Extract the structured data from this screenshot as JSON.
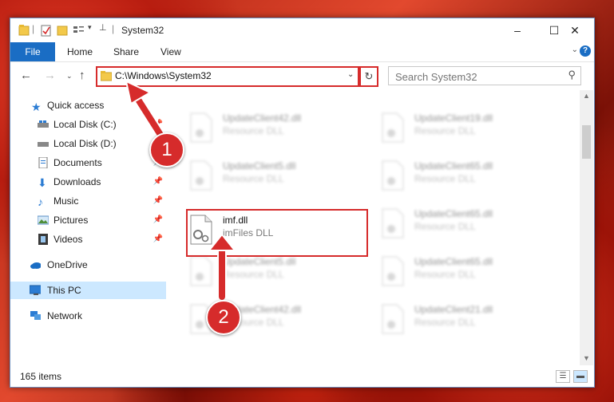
{
  "window": {
    "title": "System32"
  },
  "window_controls": {
    "minimize": "–",
    "maximize": "☐",
    "close": "✕"
  },
  "ribbon": {
    "file": "File",
    "home": "Home",
    "share": "Share",
    "view": "View",
    "help": "?"
  },
  "address": {
    "path": "C:\\Windows\\System32"
  },
  "search": {
    "placeholder": "Search System32"
  },
  "nav": {
    "items": [
      {
        "label": "Quick access",
        "icon": "star-icon"
      },
      {
        "label": "Local Disk (C:)",
        "icon": "drive-icon"
      },
      {
        "label": "Local Disk (D:)",
        "icon": "drive-icon"
      },
      {
        "label": "Documents",
        "icon": "documents-icon"
      },
      {
        "label": "Downloads",
        "icon": "download-icon"
      },
      {
        "label": "Music",
        "icon": "music-icon"
      },
      {
        "label": "Pictures",
        "icon": "pictures-icon"
      },
      {
        "label": "Videos",
        "icon": "videos-icon"
      },
      {
        "label": "OneDrive",
        "icon": "onedrive-icon"
      },
      {
        "label": "This PC",
        "icon": "computer-icon"
      },
      {
        "label": "Network",
        "icon": "network-icon"
      }
    ]
  },
  "files": [
    {
      "name": "UpdateClient42.dll",
      "type": "Resource DLL"
    },
    {
      "name": "UpdateClient19.dll",
      "type": "Resource DLL"
    },
    {
      "name": "UpdateClient5.dll",
      "type": "Resource DLL"
    },
    {
      "name": "UpdateClient65.dll",
      "type": "Resource DLL"
    },
    {
      "name": "imf.dll",
      "type": "imFiles DLL"
    },
    {
      "name": "UpdateClient65.dll",
      "type": "Resource DLL"
    },
    {
      "name": "UpdateClient5.dll",
      "type": "Resource DLL"
    },
    {
      "name": "UpdateClient65.dll",
      "type": "Resource DLL"
    },
    {
      "name": "UpdateClient42.dll",
      "type": "Resource DLL"
    },
    {
      "name": "UpdateClient21.dll",
      "type": "Resource DLL"
    }
  ],
  "status": {
    "item_count": "165 items"
  },
  "callouts": {
    "one": "1",
    "two": "2"
  },
  "colors": {
    "accent": "#1a6dc4",
    "highlight": "#d62b2b",
    "selected": "#cce8ff"
  }
}
